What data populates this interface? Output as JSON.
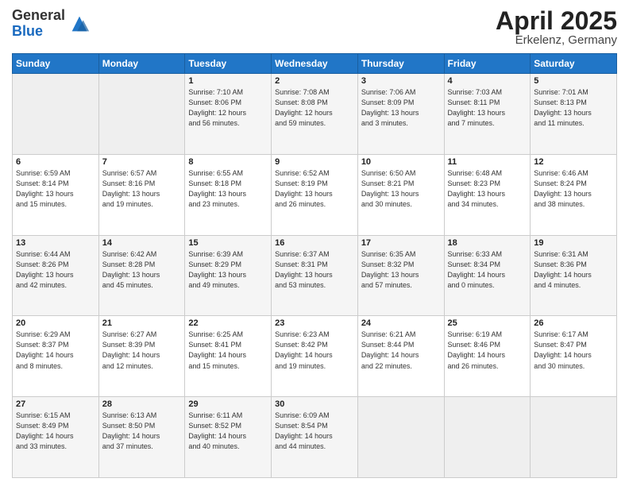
{
  "header": {
    "logo_general": "General",
    "logo_blue": "Blue",
    "title": "April 2025",
    "subtitle": "Erkelenz, Germany"
  },
  "weekdays": [
    "Sunday",
    "Monday",
    "Tuesday",
    "Wednesday",
    "Thursday",
    "Friday",
    "Saturday"
  ],
  "weeks": [
    [
      {
        "day": "",
        "info": ""
      },
      {
        "day": "",
        "info": ""
      },
      {
        "day": "1",
        "info": "Sunrise: 7:10 AM\nSunset: 8:06 PM\nDaylight: 12 hours\nand 56 minutes."
      },
      {
        "day": "2",
        "info": "Sunrise: 7:08 AM\nSunset: 8:08 PM\nDaylight: 12 hours\nand 59 minutes."
      },
      {
        "day": "3",
        "info": "Sunrise: 7:06 AM\nSunset: 8:09 PM\nDaylight: 13 hours\nand 3 minutes."
      },
      {
        "day": "4",
        "info": "Sunrise: 7:03 AM\nSunset: 8:11 PM\nDaylight: 13 hours\nand 7 minutes."
      },
      {
        "day": "5",
        "info": "Sunrise: 7:01 AM\nSunset: 8:13 PM\nDaylight: 13 hours\nand 11 minutes."
      }
    ],
    [
      {
        "day": "6",
        "info": "Sunrise: 6:59 AM\nSunset: 8:14 PM\nDaylight: 13 hours\nand 15 minutes."
      },
      {
        "day": "7",
        "info": "Sunrise: 6:57 AM\nSunset: 8:16 PM\nDaylight: 13 hours\nand 19 minutes."
      },
      {
        "day": "8",
        "info": "Sunrise: 6:55 AM\nSunset: 8:18 PM\nDaylight: 13 hours\nand 23 minutes."
      },
      {
        "day": "9",
        "info": "Sunrise: 6:52 AM\nSunset: 8:19 PM\nDaylight: 13 hours\nand 26 minutes."
      },
      {
        "day": "10",
        "info": "Sunrise: 6:50 AM\nSunset: 8:21 PM\nDaylight: 13 hours\nand 30 minutes."
      },
      {
        "day": "11",
        "info": "Sunrise: 6:48 AM\nSunset: 8:23 PM\nDaylight: 13 hours\nand 34 minutes."
      },
      {
        "day": "12",
        "info": "Sunrise: 6:46 AM\nSunset: 8:24 PM\nDaylight: 13 hours\nand 38 minutes."
      }
    ],
    [
      {
        "day": "13",
        "info": "Sunrise: 6:44 AM\nSunset: 8:26 PM\nDaylight: 13 hours\nand 42 minutes."
      },
      {
        "day": "14",
        "info": "Sunrise: 6:42 AM\nSunset: 8:28 PM\nDaylight: 13 hours\nand 45 minutes."
      },
      {
        "day": "15",
        "info": "Sunrise: 6:39 AM\nSunset: 8:29 PM\nDaylight: 13 hours\nand 49 minutes."
      },
      {
        "day": "16",
        "info": "Sunrise: 6:37 AM\nSunset: 8:31 PM\nDaylight: 13 hours\nand 53 minutes."
      },
      {
        "day": "17",
        "info": "Sunrise: 6:35 AM\nSunset: 8:32 PM\nDaylight: 13 hours\nand 57 minutes."
      },
      {
        "day": "18",
        "info": "Sunrise: 6:33 AM\nSunset: 8:34 PM\nDaylight: 14 hours\nand 0 minutes."
      },
      {
        "day": "19",
        "info": "Sunrise: 6:31 AM\nSunset: 8:36 PM\nDaylight: 14 hours\nand 4 minutes."
      }
    ],
    [
      {
        "day": "20",
        "info": "Sunrise: 6:29 AM\nSunset: 8:37 PM\nDaylight: 14 hours\nand 8 minutes."
      },
      {
        "day": "21",
        "info": "Sunrise: 6:27 AM\nSunset: 8:39 PM\nDaylight: 14 hours\nand 12 minutes."
      },
      {
        "day": "22",
        "info": "Sunrise: 6:25 AM\nSunset: 8:41 PM\nDaylight: 14 hours\nand 15 minutes."
      },
      {
        "day": "23",
        "info": "Sunrise: 6:23 AM\nSunset: 8:42 PM\nDaylight: 14 hours\nand 19 minutes."
      },
      {
        "day": "24",
        "info": "Sunrise: 6:21 AM\nSunset: 8:44 PM\nDaylight: 14 hours\nand 22 minutes."
      },
      {
        "day": "25",
        "info": "Sunrise: 6:19 AM\nSunset: 8:46 PM\nDaylight: 14 hours\nand 26 minutes."
      },
      {
        "day": "26",
        "info": "Sunrise: 6:17 AM\nSunset: 8:47 PM\nDaylight: 14 hours\nand 30 minutes."
      }
    ],
    [
      {
        "day": "27",
        "info": "Sunrise: 6:15 AM\nSunset: 8:49 PM\nDaylight: 14 hours\nand 33 minutes."
      },
      {
        "day": "28",
        "info": "Sunrise: 6:13 AM\nSunset: 8:50 PM\nDaylight: 14 hours\nand 37 minutes."
      },
      {
        "day": "29",
        "info": "Sunrise: 6:11 AM\nSunset: 8:52 PM\nDaylight: 14 hours\nand 40 minutes."
      },
      {
        "day": "30",
        "info": "Sunrise: 6:09 AM\nSunset: 8:54 PM\nDaylight: 14 hours\nand 44 minutes."
      },
      {
        "day": "",
        "info": ""
      },
      {
        "day": "",
        "info": ""
      },
      {
        "day": "",
        "info": ""
      }
    ]
  ]
}
